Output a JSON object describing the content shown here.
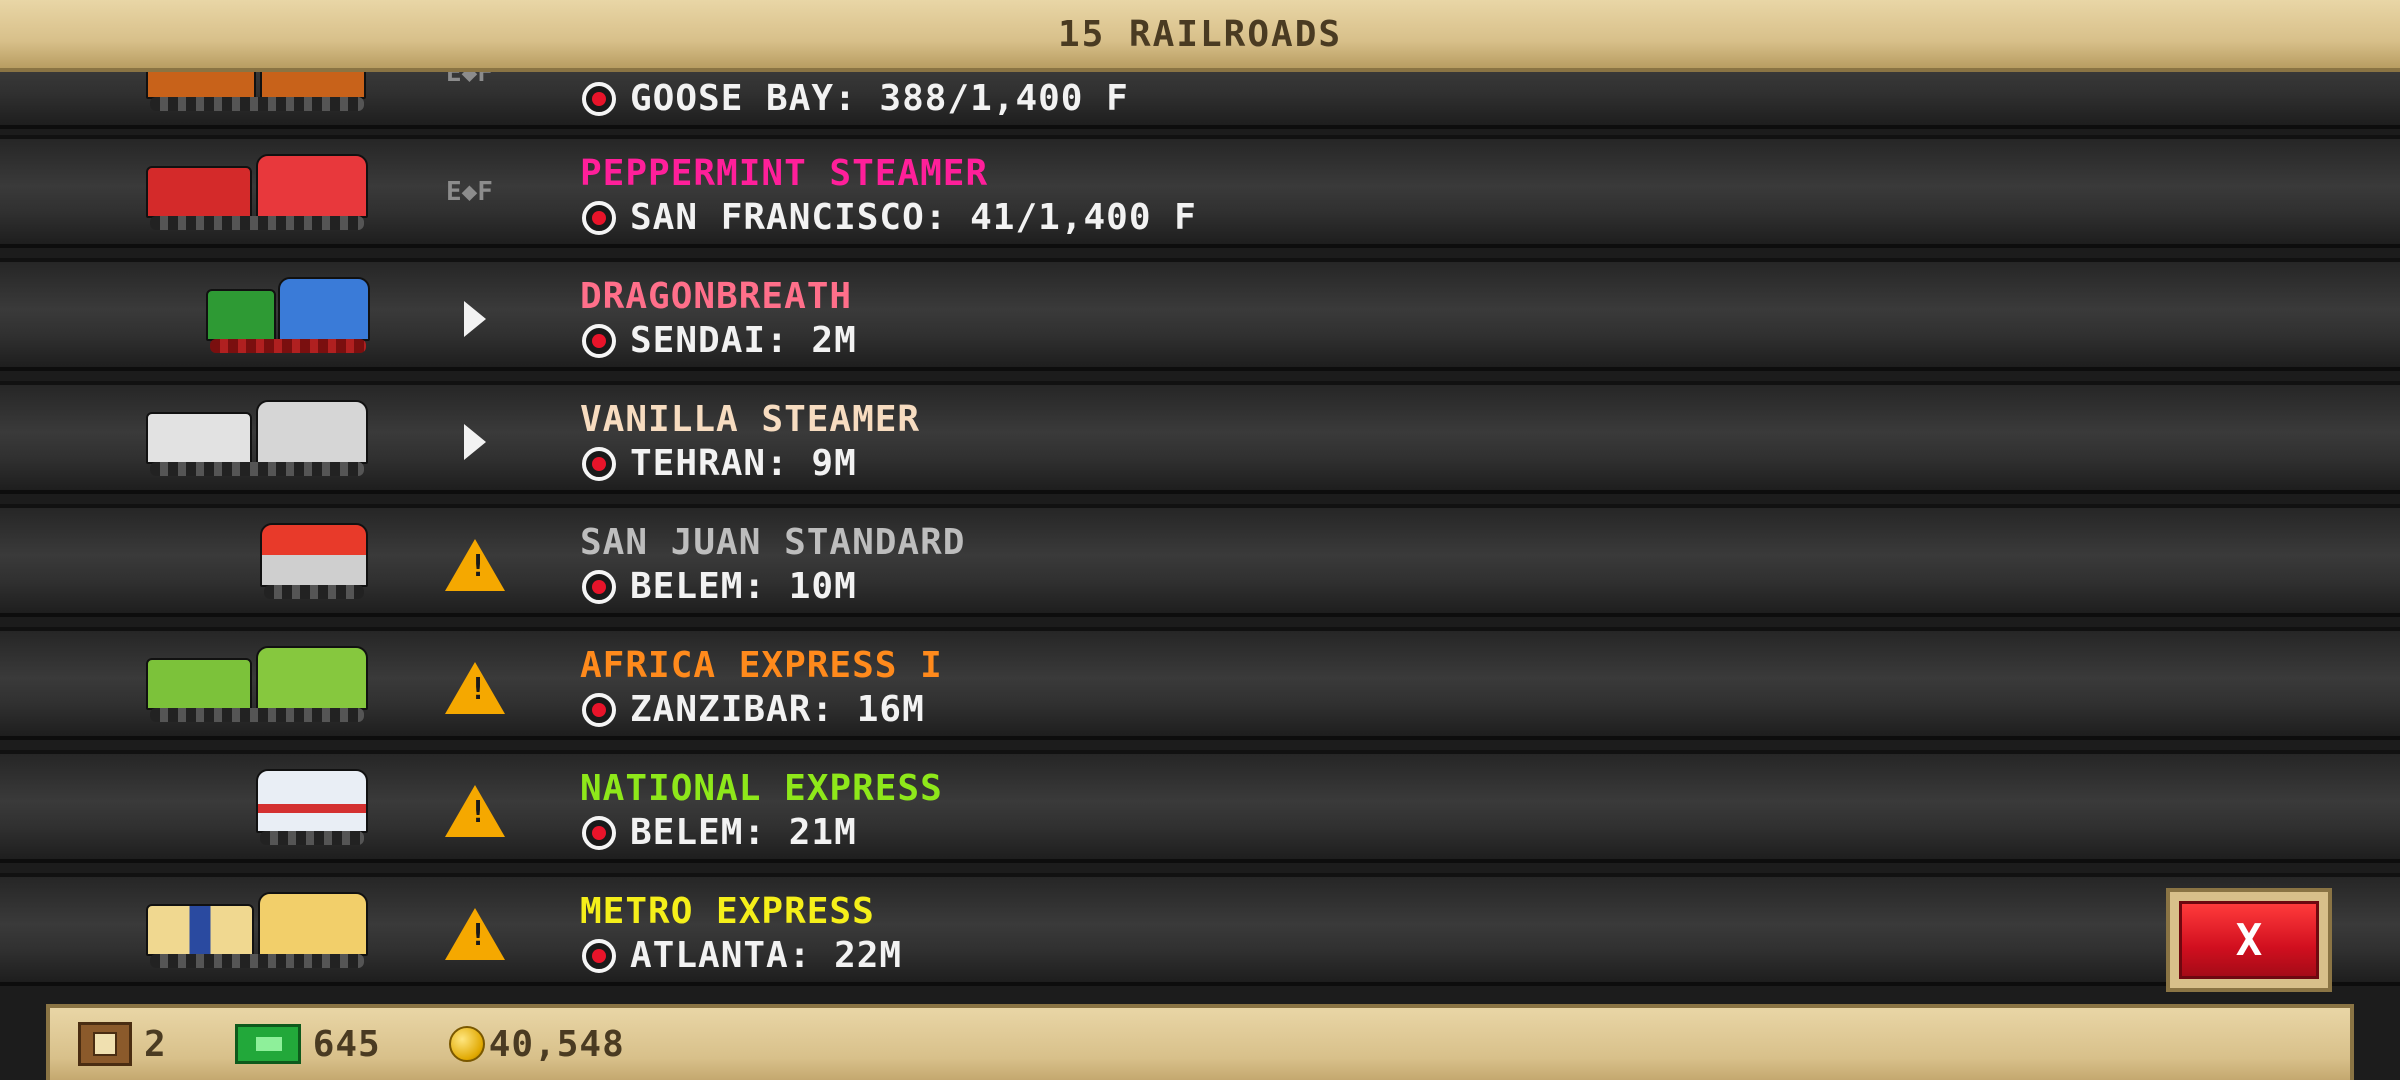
{
  "header": {
    "title": "15 RAILROADS"
  },
  "fuel_label": "E◆F",
  "rows": [
    {
      "name": "",
      "destination": "GOOSE BAY: 388/1,400 F",
      "name_color": "#ffffff",
      "status": "fuel"
    },
    {
      "name": "PEPPERMINT STEAMER",
      "destination": "SAN FRANCISCO: 41/1,400 F",
      "name_color": "#ff1f9a",
      "status": "fuel"
    },
    {
      "name": "DRAGONBREATH",
      "destination": "SENDAI: 2M",
      "name_color": "#ff6f8a",
      "status": "play"
    },
    {
      "name": "VANILLA STEAMER",
      "destination": "TEHRAN: 9M",
      "name_color": "#f7dcc0",
      "status": "play"
    },
    {
      "name": "SAN JUAN STANDARD",
      "destination": "BELEM: 10M",
      "name_color": "#bdbdbd",
      "status": "warning"
    },
    {
      "name": "AFRICA EXPRESS I",
      "destination": "ZANZIBAR: 16M",
      "name_color": "#ff8a1c",
      "status": "warning"
    },
    {
      "name": "NATIONAL EXPRESS",
      "destination": "BELEM: 21M",
      "name_color": "#8ee81a",
      "status": "warning"
    },
    {
      "name": "METRO EXPRESS",
      "destination": "ATLANTA: 22M",
      "name_color": "#f5ef1a",
      "status": "warning"
    }
  ],
  "close_button": {
    "label": "X"
  },
  "footer": {
    "crates": "2",
    "cash": "645",
    "coins": "40,548"
  },
  "icons": {
    "pin": "destination-pin-icon",
    "play": "play-icon",
    "warning": "warning-icon",
    "crate": "crate-icon",
    "cash": "cash-icon",
    "coin": "coin-icon"
  }
}
